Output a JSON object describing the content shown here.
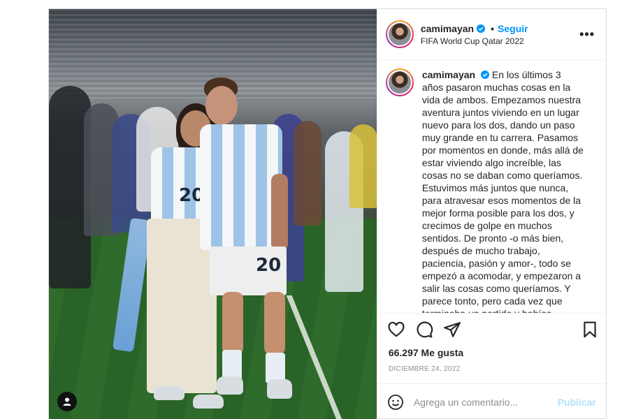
{
  "post": {
    "author": "camimayan",
    "follow_label": "Seguir",
    "location": "FIFA World Cup Qatar 2022",
    "more_icon": "more-horizontal-icon",
    "verified_icon": "verified-badge-icon",
    "caption": "En los últimos 3 años pasaron muchas cosas en la vida de ambos. Empezamos nuestra aventura juntos viviendo en un lugar nuevo para los dos, dando un paso muy grande en tu carrera. Pasamos por momentos en donde, más allá de estar viviendo algo increíble, las cosas no se daban como queríamos. Estuvimos más juntos que nunca, para atravesar esos momentos de la mejor forma posible para los dos, y crecimos de golpe en muchos sentidos. De pronto -o más bien, después de mucho trabajo, paciencia, pasión y amor-, todo se empezó a acomodar, y empezaron a salir las cosas como queríamos. Y parece tonto, pero cada vez que terminaba un partido y habías",
    "likes": "66.297 Me gusta",
    "date": "DICIEMBRE 24, 2022",
    "comment_placeholder": "Agrega un comentario...",
    "publish_label": "Publicar",
    "jersey_number_left": "20",
    "jersey_number_right": "20"
  },
  "icons": {
    "like": "heart-icon",
    "comment": "comment-icon",
    "share": "share-icon",
    "save": "bookmark-icon",
    "emoji": "emoji-icon",
    "user_tag": "user-tag-icon"
  },
  "colors": {
    "accent": "#0095f6",
    "publish_disabled": "#b2dffc",
    "muted": "#8e8e8e"
  }
}
